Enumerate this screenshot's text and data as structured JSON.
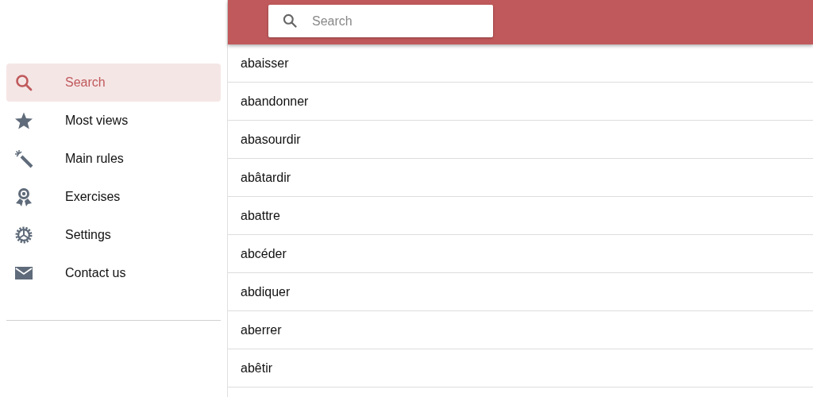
{
  "sidebar": {
    "items": [
      {
        "label": "Search",
        "selected": true
      },
      {
        "label": "Most views",
        "selected": false
      },
      {
        "label": "Main rules",
        "selected": false
      },
      {
        "label": "Exercises",
        "selected": false
      },
      {
        "label": "Settings",
        "selected": false
      },
      {
        "label": "Contact us",
        "selected": false
      }
    ]
  },
  "header": {
    "search": {
      "placeholder": "Search"
    }
  },
  "words": [
    "abaisser",
    "abandonner",
    "abasourdir",
    "abâtardir",
    "abattre",
    "abcéder",
    "abdiquer",
    "aberrer",
    "abêtir"
  ]
}
